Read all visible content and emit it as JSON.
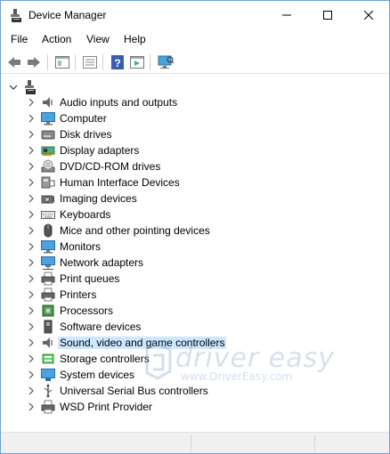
{
  "window": {
    "title": "Device Manager"
  },
  "menubar": {
    "items": [
      "File",
      "Action",
      "View",
      "Help"
    ]
  },
  "toolbar": {
    "buttons": [
      "back-icon",
      "forward-icon",
      "properties-window-icon",
      "list-view-icon",
      "help-icon",
      "run-action-icon",
      "scan-hardware-icon"
    ]
  },
  "tree": {
    "root": {
      "icon": "computer-tower-icon",
      "label": ""
    },
    "items": [
      {
        "label": "Audio inputs and outputs",
        "icon": "speaker-icon"
      },
      {
        "label": "Computer",
        "icon": "monitor-icon"
      },
      {
        "label": "Disk drives",
        "icon": "disk-drive-icon"
      },
      {
        "label": "Display adapters",
        "icon": "display-adapter-icon"
      },
      {
        "label": "DVD/CD-ROM drives",
        "icon": "dvd-icon"
      },
      {
        "label": "Human Interface Devices",
        "icon": "hid-icon"
      },
      {
        "label": "Imaging devices",
        "icon": "camera-icon"
      },
      {
        "label": "Keyboards",
        "icon": "keyboard-icon"
      },
      {
        "label": "Mice and other pointing devices",
        "icon": "mouse-icon"
      },
      {
        "label": "Monitors",
        "icon": "monitor-icon"
      },
      {
        "label": "Network adapters",
        "icon": "network-icon"
      },
      {
        "label": "Print queues",
        "icon": "printer-icon"
      },
      {
        "label": "Printers",
        "icon": "printer-icon"
      },
      {
        "label": "Processors",
        "icon": "processor-icon"
      },
      {
        "label": "Software devices",
        "icon": "software-device-icon"
      },
      {
        "label": "Sound, video and game controllers",
        "icon": "speaker-icon"
      },
      {
        "label": "Storage controllers",
        "icon": "storage-icon"
      },
      {
        "label": "System devices",
        "icon": "system-icon"
      },
      {
        "label": "Universal Serial Bus controllers",
        "icon": "usb-icon"
      },
      {
        "label": "WSD Print Provider",
        "icon": "printer-icon"
      }
    ],
    "selected_index": 15,
    "selection_color": "#cce8ff"
  },
  "watermark": {
    "brand": "driver easy",
    "url": "www.DriverEasy.com"
  },
  "colors": {
    "window_border": "#6fa0d8",
    "accent": "#1e73be"
  }
}
